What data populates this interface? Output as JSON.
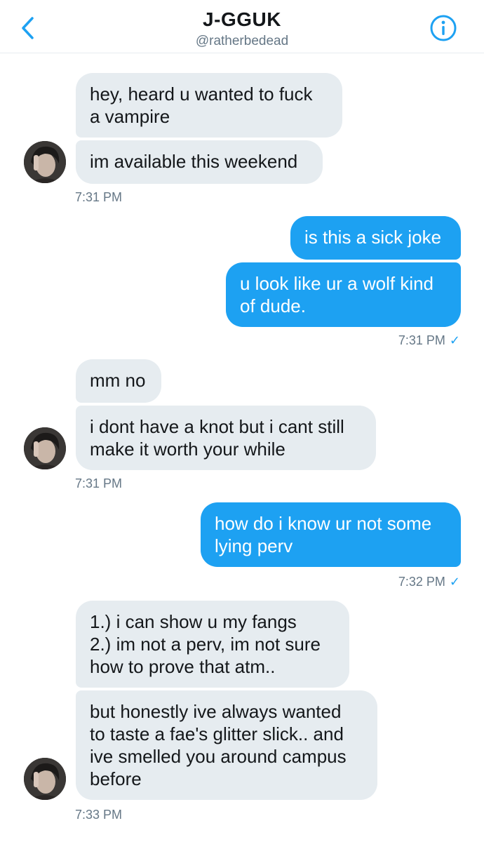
{
  "header": {
    "title": "J-GGUK",
    "handle": "@ratherbedead"
  },
  "messages": [
    {
      "from": "them",
      "text": "hey, heard u wanted to fuck\na vampire"
    },
    {
      "from": "them",
      "text": "im available this weekend"
    },
    {
      "from": "me",
      "text": "is this a sick joke"
    },
    {
      "from": "me",
      "text": "u look like ur a wolf kind\nof dude."
    },
    {
      "from": "them",
      "text": "mm no"
    },
    {
      "from": "them",
      "text": "i dont have a knot but i cant still\nmake it worth your while"
    },
    {
      "from": "me",
      "text": "how do i know ur not some\nlying perv"
    },
    {
      "from": "them",
      "text": "1.) i can show u my fangs\n2.) im not a perv, im not sure\nhow to prove that atm.."
    },
    {
      "from": "them",
      "text": "but honestly ive always wanted\nto taste a fae's glitter slick.. and\nive smelled you around campus\nbefore"
    }
  ],
  "timestamps": [
    "7:31 PM",
    "7:31 PM",
    "7:31 PM",
    "7:32 PM",
    "7:33 PM"
  ],
  "read_mark": "✓",
  "icons": {
    "back": "chevron-left-icon",
    "info": "info-circle-icon"
  },
  "colors": {
    "accent": "#1da1f2",
    "incoming_bubble": "#e6ecf0",
    "muted_text": "#657786"
  }
}
